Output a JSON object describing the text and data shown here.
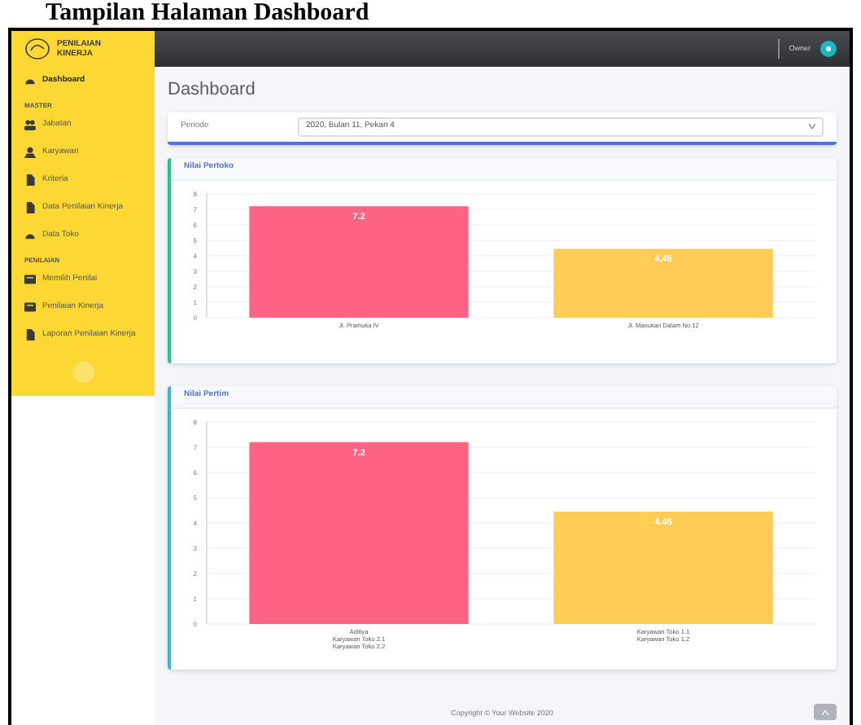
{
  "document_heading": "Tampilan Halaman Dashboard",
  "sidebar": {
    "brand": "PENILAIAN KINERJA",
    "items": [
      {
        "kind": "link",
        "label": "Dashboard",
        "selected": true
      },
      {
        "kind": "section",
        "label": "MASTER"
      },
      {
        "kind": "link",
        "label": "Jabatan",
        "selected": false
      },
      {
        "kind": "link",
        "label": "Karyawan",
        "selected": false
      },
      {
        "kind": "link",
        "label": "Kriteria",
        "selected": false
      },
      {
        "kind": "link",
        "label": "Data Penilaian Kinerja",
        "selected": false
      },
      {
        "kind": "link",
        "label": "Data Toko",
        "selected": false
      },
      {
        "kind": "section",
        "label": "PENILAIAN"
      },
      {
        "kind": "link",
        "label": "Memilih Penilai",
        "selected": false
      },
      {
        "kind": "link",
        "label": "Penilaian Kinerja",
        "selected": false
      },
      {
        "kind": "link",
        "label": "Laporan Penilaian Kinerja",
        "selected": false
      }
    ]
  },
  "topbar": {
    "user": "Owner"
  },
  "page_title": "Dashboard",
  "filter": {
    "label": "Periode",
    "value": "2020, Bulan 11, Pekan 4"
  },
  "cards": [
    {
      "title": "Nilai Pertoko",
      "chart_data": {
        "type": "bar",
        "categories": [
          "Jl. Pramuka IV",
          "Jl. Manukan Dalam No.12"
        ],
        "series": [
          {
            "color": "#ff6384",
            "values": [
              7.2,
              null
            ]
          },
          {
            "color": "#ffcd56",
            "values": [
              null,
              4.45
            ]
          }
        ],
        "ylim": [
          0,
          8
        ],
        "yticks": [
          0,
          1,
          2,
          3,
          4,
          5,
          6,
          7,
          8
        ],
        "grid": true,
        "data_labels": true
      }
    },
    {
      "title": "Nilai Pertim",
      "chart_data": {
        "type": "bar",
        "categories": [
          "Aditiya\nKaryawan Toko 2.1\nKaryawan Toko 2.2",
          "Karyawan Toko 1.1\nKaryawan Toko 1.2"
        ],
        "series": [
          {
            "color": "#ff6384",
            "values": [
              7.2,
              null
            ]
          },
          {
            "color": "#ffcd56",
            "values": [
              null,
              4.45
            ]
          }
        ],
        "ylim": [
          0,
          8
        ],
        "yticks": [
          0,
          1,
          2,
          3,
          4,
          5,
          6,
          7,
          8
        ],
        "grid": true,
        "data_labels": true
      }
    }
  ],
  "footer": "Copyright © Your Website 2020"
}
